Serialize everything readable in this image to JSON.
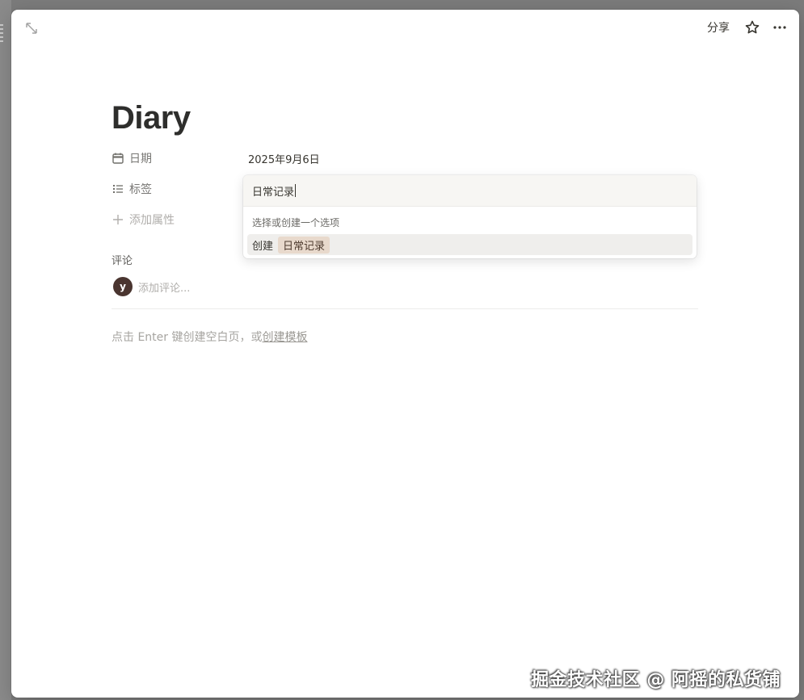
{
  "topbar": {
    "share_label": "分享"
  },
  "page": {
    "title": "Diary"
  },
  "properties": [
    {
      "icon": "calendar-icon",
      "label": "日期",
      "value": "2025年9月6日"
    },
    {
      "icon": "list-icon",
      "label": "标签",
      "value": ""
    }
  ],
  "add_property_label": "添加属性",
  "comments": {
    "label": "评论",
    "avatar_initial": "y",
    "placeholder": "添加评论..."
  },
  "empty_hint": {
    "text": "点击 Enter 键创建空白页，或",
    "link": "创建模板"
  },
  "tag_dropdown": {
    "input_value": "日常记录",
    "hint": "选择或创建一个选项",
    "create_label": "创建",
    "new_tag": "日常记录",
    "tag_color": "#e8d9cc"
  },
  "watermark": "掘金技术社区 @ 阿摇的私货铺"
}
